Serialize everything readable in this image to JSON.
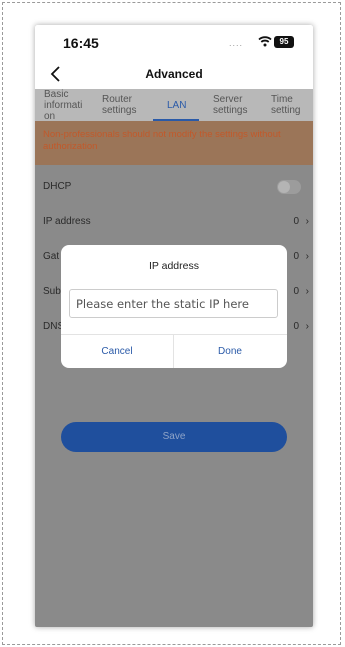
{
  "status": {
    "time": "16:45",
    "signal_dots": "....",
    "battery": "95"
  },
  "nav": {
    "title": "Advanced"
  },
  "tabs": [
    {
      "label": "Basic\ninformati\non"
    },
    {
      "label": "Router\nsettings"
    },
    {
      "label": "LAN"
    },
    {
      "label": "Server\nsettings"
    },
    {
      "label": "Time\nsetting"
    }
  ],
  "warning": "Non-professionals should not modify the settings without authorization",
  "rows": [
    {
      "label": "DHCP",
      "value": ""
    },
    {
      "label": "IP address",
      "value": "0"
    },
    {
      "label": "Gat",
      "value": "0"
    },
    {
      "label": "Sub",
      "value": "0"
    },
    {
      "label": "DNS",
      "value": "0"
    }
  ],
  "save_label": "Save",
  "dialog": {
    "title": "IP address",
    "placeholder": "Please enter the static IP here",
    "cancel": "Cancel",
    "done": "Done"
  },
  "colors": {
    "accent": "#2a5aa8",
    "warning_text": "#c2592a",
    "save_button": "#1f4f9d"
  }
}
